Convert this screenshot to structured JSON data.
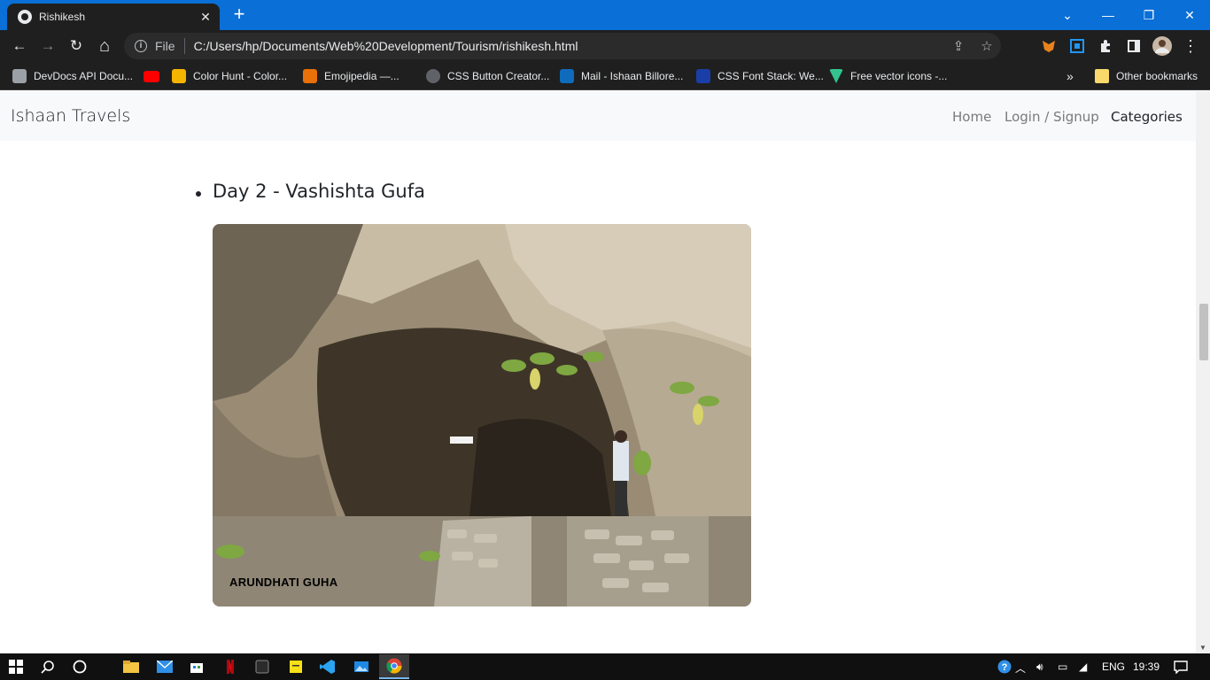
{
  "browser": {
    "tab_title": "Rishikesh",
    "tab_close": "✕",
    "new_tab": "+",
    "window_controls": {
      "minimize": "—",
      "restore": "❐",
      "close": "✕",
      "tab_search": "⌄"
    },
    "toolbar": {
      "back": "←",
      "forward": "→",
      "reload": "↻",
      "home": "⌂"
    },
    "omnibox": {
      "info": "i",
      "scheme_label": "File",
      "url": "C:/Users/hp/Documents/Web%20Development/Tourism/rishikesh.html"
    },
    "bookmarks": [
      {
        "label": "DevDocs API Docu...",
        "color": "#9aa0a6"
      },
      {
        "label": "Color Hunt - Color...",
        "color": "#f4b400"
      },
      {
        "label": "Emojipedia —...",
        "color": "#e8710a"
      },
      {
        "label": "CSS Button Creator...",
        "color": "#5f6368"
      },
      {
        "label": "Mail - Ishaan Billore...",
        "color": "#0f6cbd"
      },
      {
        "label": "CSS Font Stack: We...",
        "color": "#1a3ea8"
      },
      {
        "label": "Free vector icons -...",
        "color": "#34c38f"
      }
    ],
    "bookmarks_overflow": "»",
    "other_bookmarks": "Other bookmarks"
  },
  "navbar": {
    "brand": "Ishaan Travels",
    "links": [
      "Home",
      "Login / Signup",
      "Categories"
    ]
  },
  "content": {
    "day_heading": "Day 2 - Vashishta Gufa",
    "photo_caption": "ARUNDHATI GUHA"
  },
  "taskbar": {
    "language": "ENG",
    "time": "19:39"
  }
}
